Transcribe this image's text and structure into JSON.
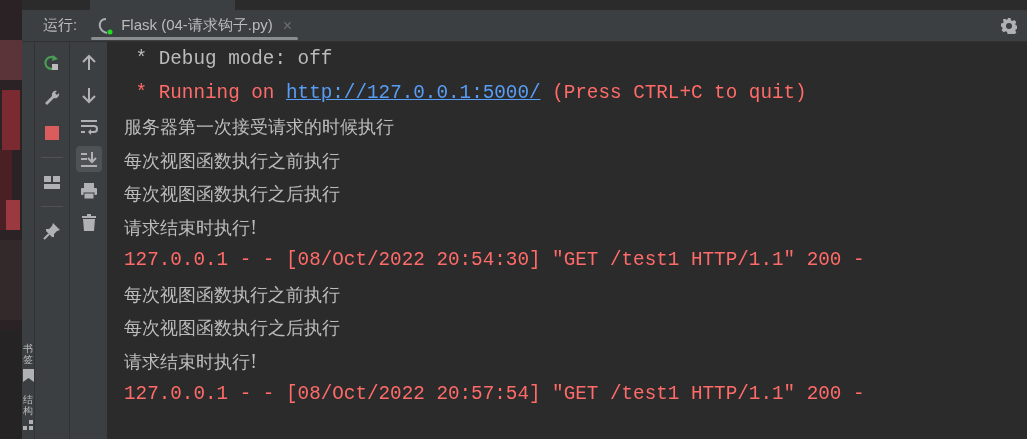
{
  "run_panel": {
    "label": "运行:",
    "tab": {
      "title": "Flask (04-请求钩子.py)",
      "close": "×",
      "selected": true,
      "running": true
    }
  },
  "toolbar": [
    {
      "kind": "rerun"
    },
    {
      "kind": "wrench"
    },
    {
      "kind": "stop"
    },
    {
      "kind": "divider"
    },
    {
      "kind": "layout"
    },
    {
      "kind": "divider"
    },
    {
      "kind": "pin"
    }
  ],
  "toolbar_2": [
    {
      "kind": "up",
      "selected": false
    },
    {
      "kind": "down",
      "selected": false
    },
    {
      "kind": "wrap",
      "selected": false
    },
    {
      "kind": "scroll-end",
      "selected": true
    },
    {
      "kind": "print",
      "selected": false
    },
    {
      "kind": "trash",
      "selected": false
    }
  ],
  "side_tabs": [
    {
      "label": "书签",
      "kind": "bookmark"
    },
    {
      "label": "结构",
      "kind": "structure"
    }
  ],
  "console": [
    {
      "kind": "out",
      "segments": [
        {
          "text": " * Debug mode: off"
        }
      ]
    },
    {
      "kind": "err",
      "segments": [
        {
          "text": " * Running on "
        },
        {
          "text": "http://127.0.0.1:5000/",
          "link": true
        },
        {
          "text": " (Press CTRL+C to quit)"
        }
      ]
    },
    {
      "kind": "cjk",
      "segments": [
        {
          "text": "服务器第一次接受请求的时候执行"
        }
      ]
    },
    {
      "kind": "cjk",
      "segments": [
        {
          "text": "每次视图函数执行之前执行"
        }
      ]
    },
    {
      "kind": "cjk",
      "segments": [
        {
          "text": "每次视图函数执行之后执行"
        }
      ]
    },
    {
      "kind": "cjk",
      "segments": [
        {
          "text": "请求结束时执行!"
        }
      ]
    },
    {
      "kind": "err",
      "segments": [
        {
          "text": "127.0.0.1 - - [08/Oct/2022 20:54:30] \"GET /test1 HTTP/1.1\" 200 -"
        }
      ]
    },
    {
      "kind": "cjk",
      "segments": [
        {
          "text": "每次视图函数执行之前执行"
        }
      ]
    },
    {
      "kind": "cjk",
      "segments": [
        {
          "text": "每次视图函数执行之后执行"
        }
      ]
    },
    {
      "kind": "cjk",
      "segments": [
        {
          "text": "请求结束时执行!"
        }
      ]
    },
    {
      "kind": "err",
      "segments": [
        {
          "text": "127.0.0.1 - - [08/Oct/2022 20:57:54] \"GET /test1 HTTP/1.1\" 200 -"
        }
      ]
    }
  ]
}
